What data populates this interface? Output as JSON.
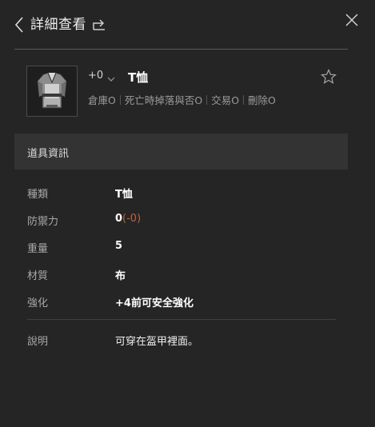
{
  "header": {
    "title": "詳細查看"
  },
  "item": {
    "enchant": "+0",
    "name": "T恤",
    "flags": [
      "倉庫O",
      "死亡時掉落與否O",
      "交易O",
      "刪除O"
    ]
  },
  "section": {
    "title": "道具資訊"
  },
  "details": {
    "type_label": "種類",
    "type_value": "T恤",
    "defense_label": "防禦力",
    "defense_value": "0",
    "defense_mod": "(-0)",
    "weight_label": "重量",
    "weight_value": "5",
    "material_label": "材質",
    "material_value": "布",
    "enhance_label": "強化",
    "enhance_value": "+4前可安全強化",
    "desc_label": "說明",
    "desc_value": "可穿在盔甲裡面。"
  },
  "colors": {
    "background": "#252525",
    "section_bg": "#333333",
    "modifier": "#c0603c"
  }
}
